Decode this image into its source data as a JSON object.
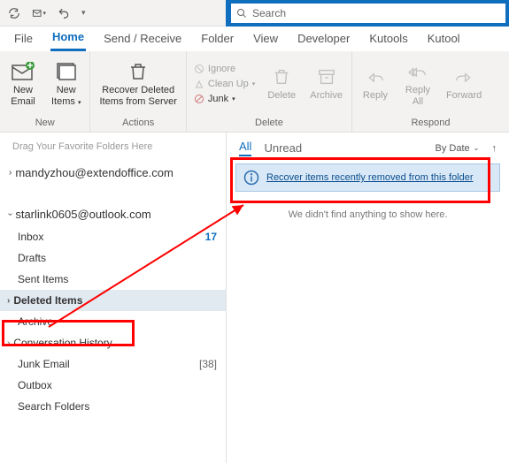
{
  "search": {
    "placeholder": "Search"
  },
  "menu": {
    "file": "File",
    "home": "Home",
    "sendrecv": "Send / Receive",
    "folder": "Folder",
    "view": "View",
    "developer": "Developer",
    "kutools": "Kutools",
    "kutool2": "Kutool"
  },
  "ribbon": {
    "new": {
      "label": "New",
      "email": "New\nEmail",
      "items": "New\nItems"
    },
    "recover": "Recover Deleted\nItems from Server",
    "actions": "Actions",
    "delete": {
      "ignore": "Ignore",
      "cleanup": "Clean Up",
      "junk": "Junk",
      "delete": "Delete",
      "archive": "Archive",
      "group": "Delete"
    },
    "respond": {
      "reply": "Reply",
      "replyall": "Reply\nAll",
      "forward": "Forward",
      "group": "Respond"
    }
  },
  "nav": {
    "drag": "Drag Your Favorite Folders Here",
    "acct1": "mandyzhou@extendoffice.com",
    "acct2": "starlink0605@outlook.com",
    "folders": {
      "inbox": "Inbox",
      "inbox_ct": "17",
      "drafts": "Drafts",
      "sent": "Sent Items",
      "deleted": "Deleted Items",
      "archive": "Archive",
      "conv": "Conversation History",
      "junk": "Junk Email",
      "junk_ct": "[38]",
      "outbox": "Outbox",
      "search": "Search Folders"
    }
  },
  "reading": {
    "all": "All",
    "unread": "Unread",
    "sort": "By Date",
    "recover": "Recover items recently removed from this folder",
    "empty": "We didn't find anything to show here."
  }
}
